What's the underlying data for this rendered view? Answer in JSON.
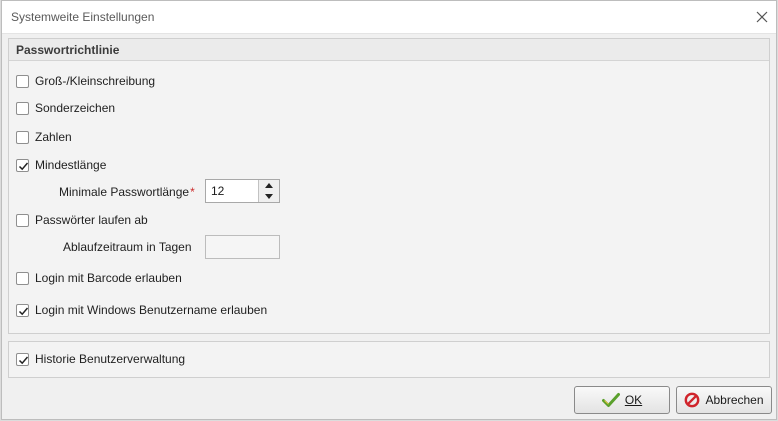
{
  "window": {
    "title": "Systemweite Einstellungen",
    "close_icon": "close-icon"
  },
  "password_policy": {
    "header": "Passwortrichtlinie",
    "options": [
      {
        "label": "Groß-/Kleinschreibung",
        "checked": false
      },
      {
        "label": "Sonderzeichen",
        "checked": false
      },
      {
        "label": "Zahlen",
        "checked": false
      },
      {
        "label": "Mindestlänge",
        "checked": true
      },
      {
        "label": "Passwörter laufen ab",
        "checked": false
      },
      {
        "label": "Login mit Barcode erlauben",
        "checked": false
      },
      {
        "label": "Login mit Windows Benutzername erlauben",
        "checked": true
      }
    ],
    "min_length": {
      "label": "Minimale Passwortlänge",
      "required_marker": "*",
      "value": "12"
    },
    "expiry": {
      "label": "Ablaufzeitraum in Tagen",
      "value": ""
    }
  },
  "history": {
    "label": "Historie Benutzerverwaltung",
    "checked": true
  },
  "buttons": {
    "ok": {
      "label": "OK",
      "icon": "check-icon"
    },
    "cancel": {
      "label": "Abbrechen",
      "icon": "prohibited-icon"
    }
  },
  "colors": {
    "check_green": "#5aa02c",
    "cancel_red": "#d0242b"
  }
}
